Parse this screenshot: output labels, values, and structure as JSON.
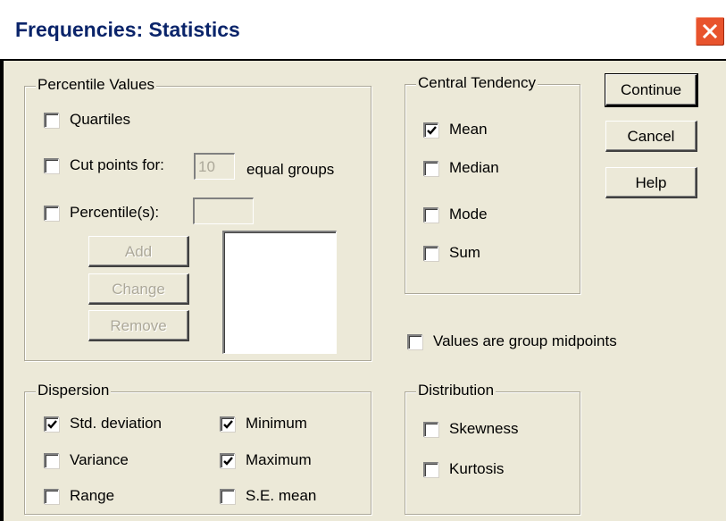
{
  "window": {
    "title": "Frequencies: Statistics",
    "close_icon": "close-icon"
  },
  "percentile_values": {
    "legend": "Percentile Values",
    "quartiles": {
      "label": "Quartiles",
      "checked": false
    },
    "cut_points": {
      "label": "Cut points for:",
      "value": "10",
      "suffix": "equal groups",
      "checked": false
    },
    "percentiles": {
      "label": "Percentile(s):",
      "value": "",
      "checked": false
    },
    "add_label": "Add",
    "change_label": "Change",
    "remove_label": "Remove"
  },
  "central_tendency": {
    "legend": "Central Tendency",
    "items": [
      {
        "label": "Mean",
        "checked": true
      },
      {
        "label": "Median",
        "checked": false
      },
      {
        "label": "Mode",
        "checked": false
      },
      {
        "label": "Sum",
        "checked": false
      }
    ]
  },
  "buttons": {
    "continue": "Continue",
    "cancel": "Cancel",
    "help": "Help"
  },
  "group_midpoints": {
    "label": "Values are group midpoints",
    "checked": false
  },
  "dispersion": {
    "legend": "Dispersion",
    "items": [
      {
        "label": "Std. deviation",
        "checked": true
      },
      {
        "label": "Variance",
        "checked": false
      },
      {
        "label": "Range",
        "checked": false
      },
      {
        "label": "Minimum",
        "checked": true
      },
      {
        "label": "Maximum",
        "checked": true
      },
      {
        "label": "S.E. mean",
        "checked": false
      }
    ]
  },
  "distribution": {
    "legend": "Distribution",
    "items": [
      {
        "label": "Skewness",
        "checked": false
      },
      {
        "label": "Kurtosis",
        "checked": false
      }
    ]
  },
  "colors": {
    "dialog_bg": "#ece9d8",
    "title_text": "#0a246a",
    "close_button": "#e8532d",
    "disabled_text": "#aca899"
  }
}
